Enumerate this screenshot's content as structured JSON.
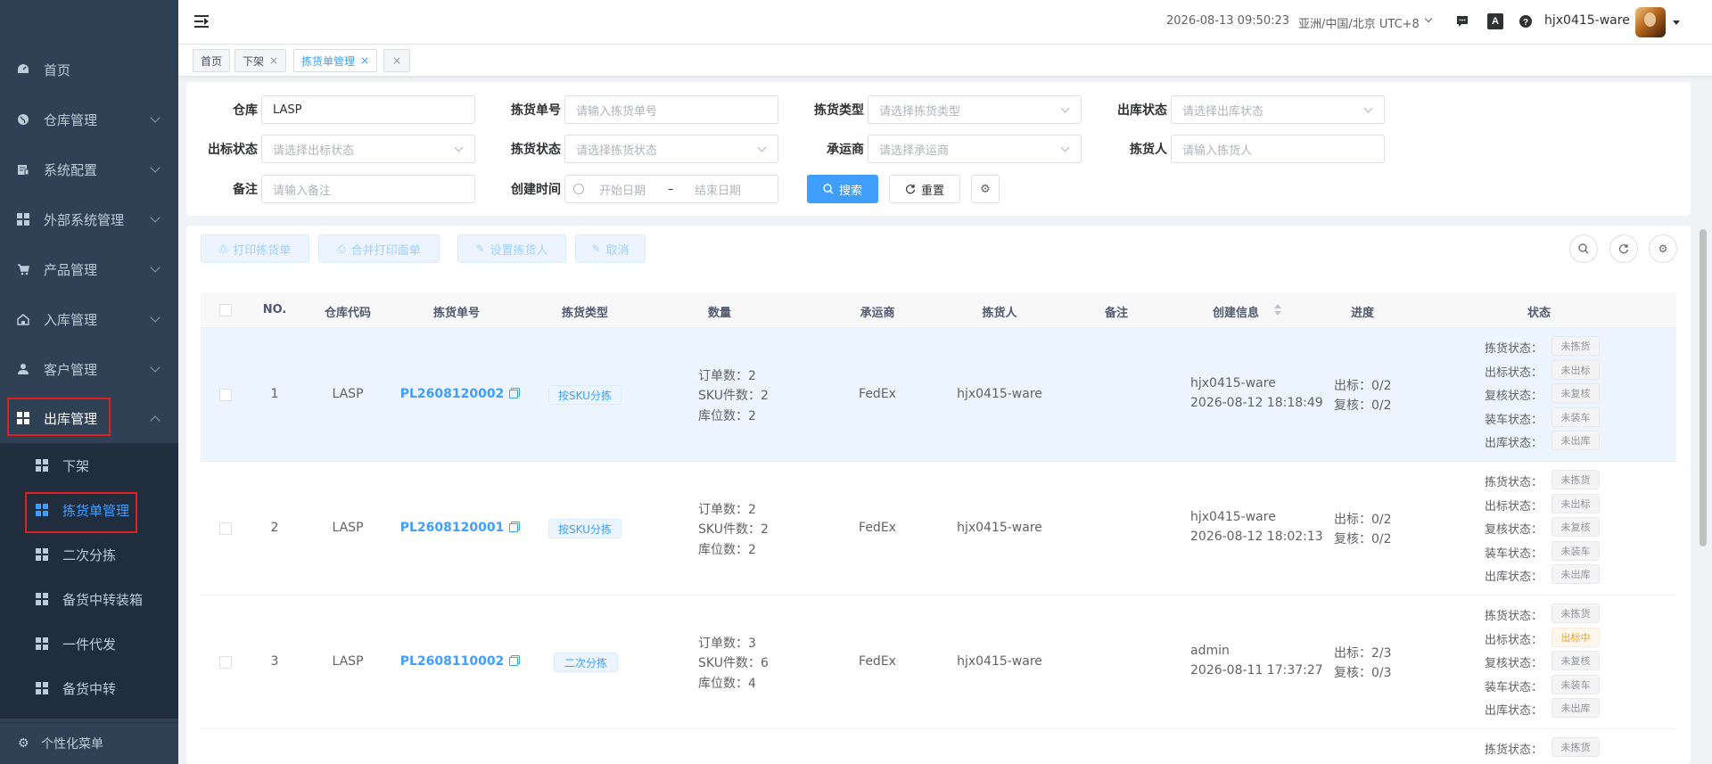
{
  "sidebar": {
    "menu": [
      {
        "label": "首页",
        "icon": "dashboard-icon"
      },
      {
        "label": "仓库管理",
        "icon": "globe-icon"
      },
      {
        "label": "系统配置",
        "icon": "config-icon"
      },
      {
        "label": "外部系统管理",
        "icon": "grid-icon"
      },
      {
        "label": "产品管理",
        "icon": "cart-icon"
      },
      {
        "label": "入库管理",
        "icon": "home-icon"
      },
      {
        "label": "客户管理",
        "icon": "user-icon"
      },
      {
        "label": "出库管理",
        "icon": "grid-icon"
      }
    ],
    "submenu": [
      {
        "label": "下架"
      },
      {
        "label": "拣货单管理"
      },
      {
        "label": "二次分拣"
      },
      {
        "label": "备货中转装箱"
      },
      {
        "label": "一件代发"
      },
      {
        "label": "备货中转"
      }
    ],
    "footer": "个性化菜单"
  },
  "header": {
    "datetime": "2026-08-13 09:50:23",
    "timezone": "亚洲/中国/北京 UTC+8",
    "username": "hjx0415-ware",
    "translate_glyph": "A"
  },
  "tags": [
    {
      "label": "首页"
    },
    {
      "label": "下架"
    },
    {
      "label": "拣货单管理"
    }
  ],
  "search": {
    "warehouse_label": "仓库",
    "warehouse_value": "LASP",
    "pick_no_label": "拣货单号",
    "pick_no_placeholder": "请输入拣货单号",
    "pick_type_label": "拣货类型",
    "pick_type_placeholder": "请选择拣货类型",
    "out_status_label": "出库状态",
    "out_status_placeholder": "请选择出库状态",
    "label_status_label": "出标状态",
    "label_status_placeholder": "请选择出标状态",
    "pick_status_label": "拣货状态",
    "pick_status_placeholder": "请选择拣货状态",
    "carrier_label": "承运商",
    "carrier_placeholder": "请选择承运商",
    "picker_label": "拣货人",
    "picker_placeholder": "请输入拣货人",
    "remark_label": "备注",
    "remark_placeholder": "请输入备注",
    "created_label": "创建时间",
    "start_placeholder": "开始日期",
    "range_sep": "–",
    "end_placeholder": "结束日期",
    "search_btn": "搜索",
    "reset_btn": "重置"
  },
  "toolbar": {
    "print": "打印拣货单",
    "merge_print": "合并打印面单",
    "set_picker": "设置拣货人",
    "cancel": "取消"
  },
  "table": {
    "columns": [
      "NO.",
      "仓库代码",
      "拣货单号",
      "拣货类型",
      "数量",
      "承运商",
      "拣货人",
      "备注",
      "创建信息",
      "进度",
      "状态"
    ],
    "qty_labels": {
      "orders": "订单数：",
      "sku": "SKU件数：",
      "locations": "库位数："
    },
    "progress_labels": {
      "label": "出标：",
      "review": "复核："
    },
    "status_labels": [
      "拣货状态：",
      "出标状态：",
      "复核状态：",
      "装车状态：",
      "出库状态："
    ],
    "rows": [
      {
        "no": "1",
        "warehouse": "LASP",
        "pick_no": "PL2608120002",
        "type": "按SKU分拣",
        "orders": "2",
        "sku": "2",
        "locations": "2",
        "carrier": "FedEx",
        "picker": "hjx0415-ware",
        "remark": "",
        "creator": "hjx0415-ware",
        "created": "2026-08-12 18:18:49",
        "label_progress": "0/2",
        "review_progress": "0/2",
        "statuses": [
          "未拣货",
          "未出标",
          "未复核",
          "未装车",
          "未出库"
        ]
      },
      {
        "no": "2",
        "warehouse": "LASP",
        "pick_no": "PL2608120001",
        "type": "按SKU分拣",
        "orders": "2",
        "sku": "2",
        "locations": "2",
        "carrier": "FedEx",
        "picker": "hjx0415-ware",
        "remark": "",
        "creator": "hjx0415-ware",
        "created": "2026-08-12 18:02:13",
        "label_progress": "0/2",
        "review_progress": "0/2",
        "statuses": [
          "未拣货",
          "未出标",
          "未复核",
          "未装车",
          "未出库"
        ]
      },
      {
        "no": "3",
        "warehouse": "LASP",
        "pick_no": "PL2608110002",
        "type": "二次分拣",
        "orders": "3",
        "sku": "6",
        "locations": "4",
        "carrier": "FedEx",
        "picker": "hjx0415-ware",
        "remark": "",
        "creator": "admin",
        "created": "2026-08-11 17:37:27",
        "label_progress": "2/3",
        "review_progress": "0/3",
        "statuses": [
          "未拣货",
          "出标中",
          "未复核",
          "未装车",
          "未出库"
        ]
      },
      {
        "statuses": [
          "未拣货"
        ]
      }
    ]
  },
  "colors": {
    "accent": "#409eff",
    "sidebar": "#304156",
    "submenu": "#1f2d3d",
    "highlight": "#e02020",
    "warn": "#e6a23c"
  }
}
